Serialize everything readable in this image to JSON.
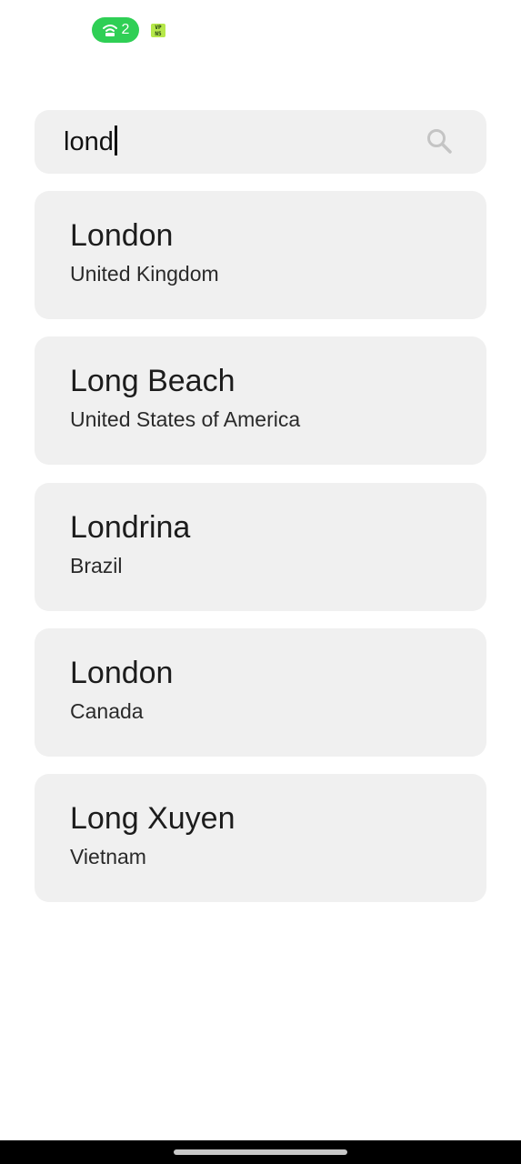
{
  "status_bar": {
    "hotspot_count": "2",
    "hotspot_icon": "wifi-hotspot-icon",
    "hotspot_color": "#2fcf55",
    "vpn_badge": "VPN",
    "vpn_icon": "vpn-key-icon",
    "vpn_color": "#b6e84a"
  },
  "search": {
    "value": "lond",
    "icon": "search-icon"
  },
  "results": [
    {
      "city": "London",
      "country": "United Kingdom"
    },
    {
      "city": "Long Beach",
      "country": "United States of America"
    },
    {
      "city": "Londrina",
      "country": "Brazil"
    },
    {
      "city": "London",
      "country": "Canada"
    },
    {
      "city": "Long Xuyen",
      "country": "Vietnam"
    }
  ],
  "colors": {
    "card_background": "#f0f0f0",
    "page_background": "#ffffff"
  }
}
